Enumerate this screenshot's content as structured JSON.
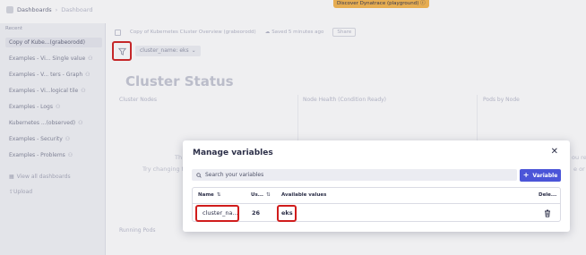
{
  "topbar": {
    "app_name": "Dashboards",
    "breadcrumb": "Dashboard",
    "discover_banner": "Discover Dynatrace (playground)"
  },
  "sidebar": {
    "section_label": "Recent",
    "items": [
      {
        "label": "Copy of Kube...(grabeorodd)",
        "shared": false
      },
      {
        "label": "Examples - Vi... Single value",
        "shared": true
      },
      {
        "label": "Examples - V... ters - Graph",
        "shared": true
      },
      {
        "label": "Examples - Vi...logical tile",
        "shared": true
      },
      {
        "label": "Examples - Logs",
        "shared": true
      },
      {
        "label": "Kubernetes ...(observed)",
        "shared": true
      },
      {
        "label": "Examples - Security",
        "shared": true
      },
      {
        "label": "Examples - Problems",
        "shared": true
      }
    ],
    "view_all_label": "View all dashboards",
    "upload_label": "Upload"
  },
  "document": {
    "title": "Copy of Kubernetes Cluster Overview (grabeorodd)",
    "saved_status": "Saved 5 minutes ago",
    "share_label": "Share",
    "variable_chip": "cluster_name: eks"
  },
  "dashboard": {
    "heading": "Cluster Status",
    "tiles": {
      "cluster_nodes": "Cluster Nodes",
      "node_health": "Node Health (Condition Ready)",
      "pods_by_node": "Pods by Node",
      "running_pods": "Running Pods"
    },
    "ghost_left": "Th",
    "ghost_left2": "Try changing th",
    "ghost_right": "ou rec",
    "ghost_right2": "e or i"
  },
  "modal": {
    "title": "Manage variables",
    "close_icon": "close-icon",
    "search_placeholder": "Search your variables",
    "add_button_label": "Variable",
    "columns": {
      "name": "Name",
      "usage": "Us...",
      "available_values": "Available values",
      "delete": "Dele..."
    },
    "rows": [
      {
        "name": "cluster_na...",
        "usage": "26",
        "available_values": "eks"
      }
    ]
  },
  "colors": {
    "accent": "#4b55d8",
    "highlight_box": "#d01c1c",
    "banner": "#f5b44a"
  }
}
